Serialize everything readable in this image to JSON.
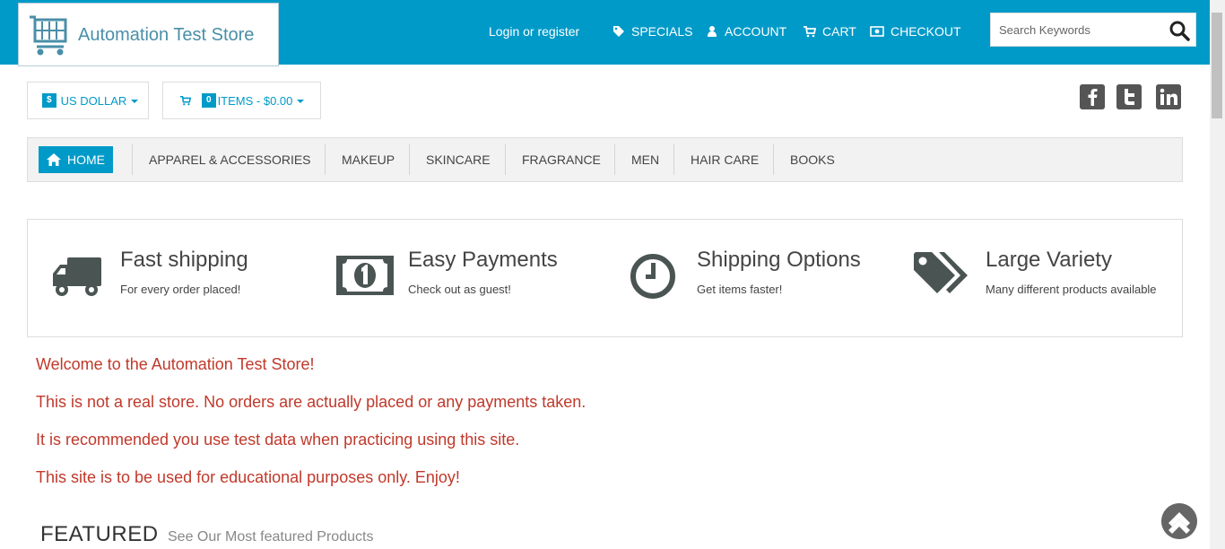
{
  "header": {
    "logo_text": "Automation Test Store",
    "login_label": "Login or register",
    "nav_links": [
      {
        "label": "SPECIALS",
        "icon": "tag-icon"
      },
      {
        "label": "ACCOUNT",
        "icon": "user-icon"
      },
      {
        "label": "CART",
        "icon": "cart-icon"
      },
      {
        "label": "CHECKOUT",
        "icon": "money-icon"
      }
    ],
    "search": {
      "placeholder": "Search Keywords",
      "value": ""
    }
  },
  "toolbar": {
    "currency_symbol": "$",
    "currency_label": "US DOLLAR",
    "cart_count": "0",
    "cart_summary": "ITEMS - $0.00"
  },
  "social": [
    "facebook-icon",
    "twitter-icon",
    "linkedin-icon"
  ],
  "nav": {
    "home": "HOME",
    "items": [
      "APPAREL & ACCESSORIES",
      "MAKEUP",
      "SKINCARE",
      "FRAGRANCE",
      "MEN",
      "HAIR CARE",
      "BOOKS"
    ]
  },
  "features": [
    {
      "title": "Fast shipping",
      "subtitle": "For every order placed!",
      "icon": "truck-icon"
    },
    {
      "title": "Easy Payments",
      "subtitle": "Check out as guest!",
      "icon": "banknote-icon"
    },
    {
      "title": "Shipping Options",
      "subtitle": "Get items faster!",
      "icon": "clock-icon"
    },
    {
      "title": "Large Variety",
      "subtitle": "Many different products available",
      "icon": "tags-icon"
    }
  ],
  "welcome": [
    "Welcome to the Automation Test Store!",
    "This is not a real store. No orders are actually placed or any payments taken.",
    "It is recommended you use test data when practicing using this site.",
    "This site is to be used for educational purposes only. Enjoy!"
  ],
  "featured": {
    "title": "FEATURED",
    "subtitle": "See Our Most featured Products"
  },
  "colors": {
    "brand": "#009ac8",
    "welcome_text": "#c0392b",
    "icon_dark": "#4a5553"
  }
}
